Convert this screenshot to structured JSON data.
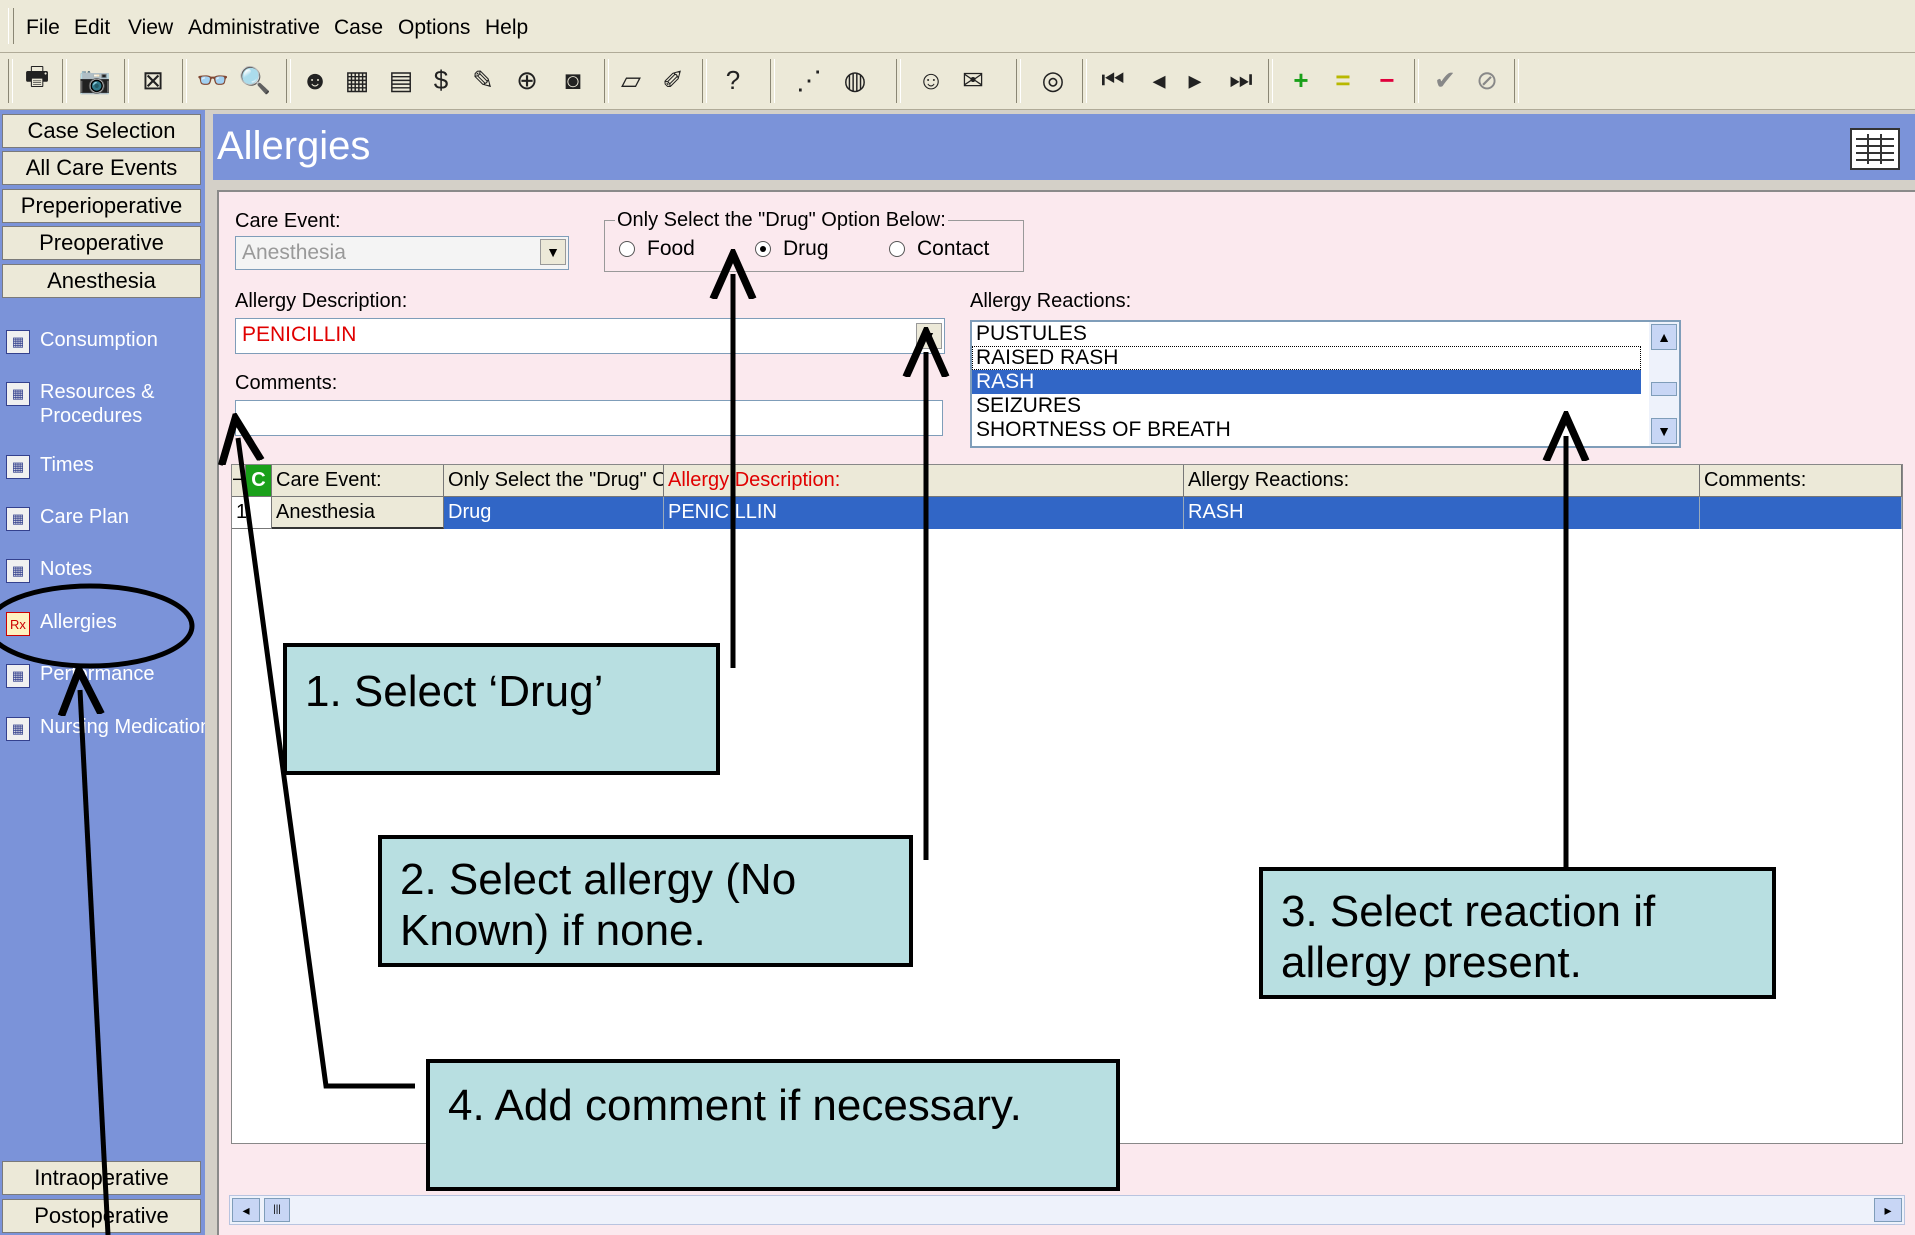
{
  "menu": [
    "File",
    "Edit",
    "View",
    "Administrative",
    "Case",
    "Options",
    "Help"
  ],
  "sidebar": {
    "top_buttons": [
      "Case Selection",
      "All Care Events",
      "Preperioperative",
      "Preoperative",
      "Anesthesia"
    ],
    "links": [
      "Consumption",
      "Resources & Procedures",
      "Times",
      "Care Plan",
      "Notes",
      "Allergies",
      "Performance",
      "Nursing Medication"
    ],
    "bottom_buttons": [
      "Intraoperative",
      "Postoperative"
    ]
  },
  "header": {
    "title": "Allergies"
  },
  "form": {
    "care_event_label": "Care Event:",
    "care_event_value": "Anesthesia",
    "radio_group_label": "Only Select the \"Drug\" Option Below:",
    "radio_options": [
      "Food",
      "Drug",
      "Contact"
    ],
    "radio_selected": "Drug",
    "allergy_desc_label": "Allergy Description:",
    "allergy_desc_value": "PENICILLIN",
    "comments_label": "Comments:",
    "comments_value": "",
    "reactions_label": "Allergy Reactions:",
    "reactions": [
      "PUSTULES",
      "RAISED RASH",
      "RASH",
      "SEIZURES",
      "SHORTNESS OF BREATH"
    ],
    "reaction_selected": "RASH"
  },
  "grid": {
    "columns": [
      "Care Event:",
      "Only Select the \"Drug\" Option Below:",
      "Allergy Description:",
      "Allergy Reactions:",
      "Comments:"
    ],
    "rows": [
      {
        "num": "1",
        "care_event": "Anesthesia",
        "type": "Drug",
        "description": "PENICILLIN",
        "reaction": "RASH",
        "comments": ""
      }
    ]
  },
  "callouts": {
    "c1": "1. Select ‘Drug’",
    "c2": "2. Select allergy (No Known) if none.",
    "c3": "3. Select reaction if allergy present.",
    "c4": "4. Add comment if necessary."
  },
  "colors": {
    "sidebar": "#7b93d9",
    "panel": "#fbe9ee",
    "selection": "#3166c6",
    "callout": "#b8dfe1"
  }
}
